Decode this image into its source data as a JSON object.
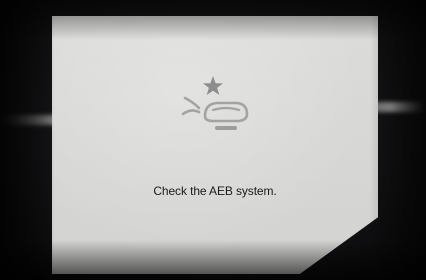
{
  "warning": {
    "icon": "aeb-warning-icon",
    "message": "Check the AEB system."
  },
  "colors": {
    "panel": "#d6d6d4",
    "icon": "#9a9a9a",
    "icon_star": "#8d8d8d",
    "text": "#1a1a1a"
  }
}
